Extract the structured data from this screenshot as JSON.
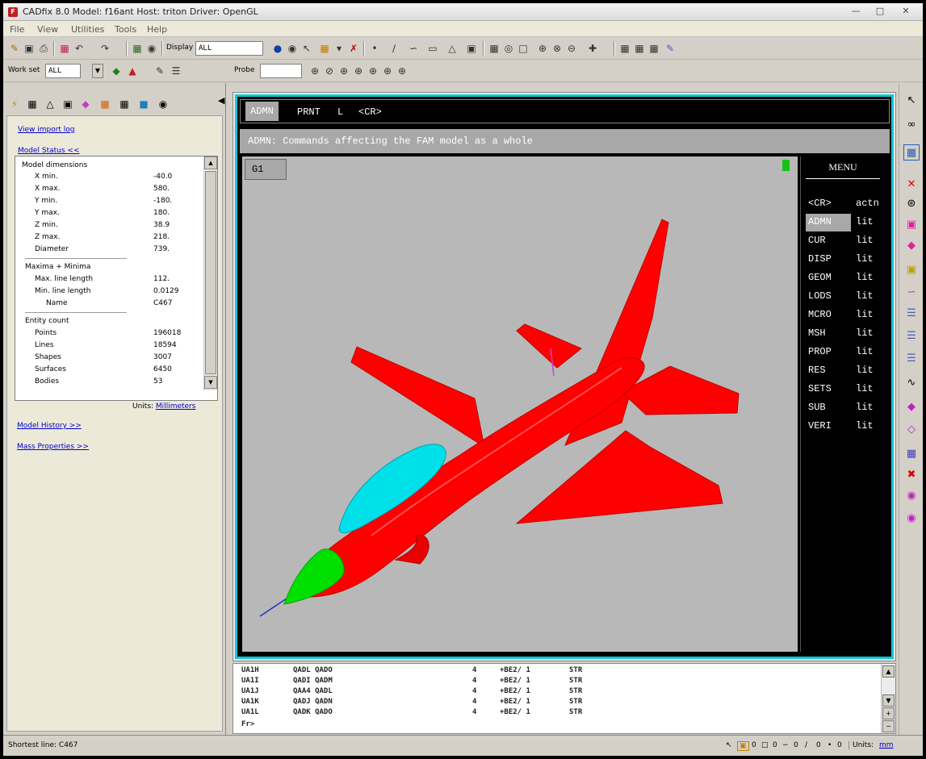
{
  "window": {
    "title": "CADfix 8.0   Model: f16ant   Host: triton   Driver: OpenGL",
    "app_icon_glyph": "F",
    "controls": [
      "—",
      "□",
      "✕"
    ]
  },
  "menubar": {
    "items": [
      "File",
      "View",
      "Utilities",
      "Tools",
      "Help"
    ]
  },
  "toolbar1": {
    "display_label": "Display",
    "display_value": "ALL"
  },
  "toolbar2": {
    "workset_label": "Work set",
    "workset_value": "ALL",
    "probe_label": "Probe",
    "probe_value": ""
  },
  "left_panel": {
    "links": {
      "import_log": "View import log",
      "model_status": "Model Status <<",
      "model_history": "Model History >>",
      "mass_properties": "Mass Properties >>"
    },
    "model_dimensions": {
      "header": "Model dimensions",
      "rows": [
        {
          "label": "X min.",
          "value": "-40.0"
        },
        {
          "label": "X max.",
          "value": "580."
        },
        {
          "label": "Y min.",
          "value": "-180."
        },
        {
          "label": "Y max.",
          "value": "180."
        },
        {
          "label": "Z min.",
          "value": "38.9"
        },
        {
          "label": "Z max.",
          "value": "218."
        },
        {
          "label": "Diameter",
          "value": "739."
        }
      ]
    },
    "maxima_minima": {
      "header": "Maxima + Minima",
      "rows": [
        {
          "label": "Max. line length",
          "value": "112."
        },
        {
          "label": "Min. line length",
          "value": "0.0129"
        },
        {
          "label": "Name",
          "value": "C467"
        }
      ]
    },
    "entity_count": {
      "header": "Entity count",
      "rows": [
        {
          "label": "Points",
          "value": "196018"
        },
        {
          "label": "Lines",
          "value": "18594"
        },
        {
          "label": "Shapes",
          "value": "3007"
        },
        {
          "label": "Surfaces",
          "value": "6450"
        },
        {
          "label": "Bodies",
          "value": "53"
        }
      ]
    },
    "units_label": "Units:",
    "units_value": "Millimeters"
  },
  "graphics": {
    "command_bar": [
      "ADMN",
      "PRNT",
      "L",
      "<CR>"
    ],
    "description": "ADMN: Commands affecting the FAM model as a whole",
    "view_label": "G1",
    "model_colors": {
      "body": "#ff0000",
      "canopy": "#00e0e8",
      "nose": "#00e000",
      "background": "#b8b8b8"
    }
  },
  "menu": {
    "title": "MENU",
    "items": [
      {
        "cmd": "<CR>",
        "type": "actn"
      },
      {
        "cmd": "ADMN",
        "type": "lit"
      },
      {
        "cmd": "CUR",
        "type": "lit"
      },
      {
        "cmd": "DISP",
        "type": "lit"
      },
      {
        "cmd": "GEOM",
        "type": "lit"
      },
      {
        "cmd": "LODS",
        "type": "lit"
      },
      {
        "cmd": "MCRO",
        "type": "lit"
      },
      {
        "cmd": "MSH",
        "type": "lit"
      },
      {
        "cmd": "PROP",
        "type": "lit"
      },
      {
        "cmd": "RES",
        "type": "lit"
      },
      {
        "cmd": "SETS",
        "type": "lit"
      },
      {
        "cmd": "SUB",
        "type": "lit"
      },
      {
        "cmd": "VERI",
        "type": "lit"
      }
    ]
  },
  "console": {
    "rows": [
      [
        "UA1H",
        "QADL QADO",
        "4",
        "+BE2/ 1",
        "STR"
      ],
      [
        "UA1I",
        "QADI QADM",
        "4",
        "+BE2/ 1",
        "STR"
      ],
      [
        "UA1J",
        "QAA4 QADL",
        "4",
        "+BE2/ 1",
        "STR"
      ],
      [
        "UA1K",
        "QADJ QADN",
        "4",
        "+BE2/ 1",
        "STR"
      ],
      [
        "UA1L",
        "QADK QADO",
        "4",
        "+BE2/ 1",
        "STR"
      ]
    ],
    "prompt": "Fr>"
  },
  "status": {
    "text": "Shortest line: C467",
    "counters": [
      "0",
      "0",
      "0",
      "0",
      "0"
    ],
    "units_label": "Units:",
    "units_value": "mm"
  }
}
